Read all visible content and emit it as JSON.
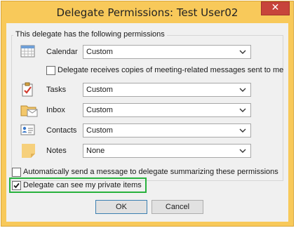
{
  "window": {
    "title": "Delegate Permissions: Test User02",
    "close_glyph": "✕"
  },
  "group": {
    "label": "This delegate has the following permissions"
  },
  "permissions": [
    {
      "label": "Calendar",
      "value": "Custom",
      "icon": "calendar-icon"
    },
    {
      "label": "Tasks",
      "value": "Custom",
      "icon": "tasks-icon"
    },
    {
      "label": "Inbox",
      "value": "Custom",
      "icon": "inbox-icon"
    },
    {
      "label": "Contacts",
      "value": "Custom",
      "icon": "contacts-icon"
    },
    {
      "label": "Notes",
      "value": "None",
      "icon": "notes-icon"
    }
  ],
  "meeting_copies": {
    "label": "Delegate receives copies of meeting-related messages sent to me",
    "checked": false
  },
  "auto_send": {
    "label": "Automatically send a message to delegate summarizing these permissions",
    "checked": false
  },
  "private_items": {
    "label": "Delegate can see my private items",
    "checked": true
  },
  "buttons": {
    "ok": "OK",
    "cancel": "Cancel"
  },
  "colors": {
    "title_bar": "#f8c95a",
    "close_button": "#c7443b",
    "highlight": "#28b13d"
  }
}
